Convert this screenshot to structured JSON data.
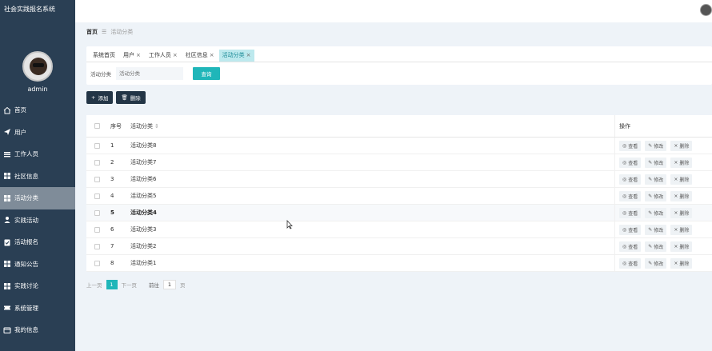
{
  "app": {
    "title": "社会实践报名系统"
  },
  "user": {
    "name": "admin"
  },
  "sidebar": {
    "items": [
      {
        "label": "首页",
        "icon": "home-icon",
        "active": false
      },
      {
        "label": "用户",
        "icon": "send-icon",
        "active": false
      },
      {
        "label": "工作人员",
        "icon": "list-icon",
        "active": false
      },
      {
        "label": "社区信息",
        "icon": "grid-icon",
        "active": false
      },
      {
        "label": "活动分类",
        "icon": "grid-icon",
        "active": true
      },
      {
        "label": "实践活动",
        "icon": "person-icon",
        "active": false
      },
      {
        "label": "活动报名",
        "icon": "clipboard-icon",
        "active": false
      },
      {
        "label": "通知公告",
        "icon": "grid-icon",
        "active": false
      },
      {
        "label": "实践讨论",
        "icon": "grid-icon",
        "active": false
      },
      {
        "label": "系统管理",
        "icon": "ticket-icon",
        "active": false
      },
      {
        "label": "我的信息",
        "icon": "card-icon",
        "active": false
      }
    ]
  },
  "breadcrumb": {
    "home": "首页",
    "separator": "☰",
    "current": "活动分类"
  },
  "tabs": [
    {
      "label": "系统首页",
      "closable": false,
      "active": false
    },
    {
      "label": "用户",
      "closable": true,
      "active": false
    },
    {
      "label": "工作人员",
      "closable": true,
      "active": false
    },
    {
      "label": "社区信息",
      "closable": true,
      "active": false
    },
    {
      "label": "活动分类",
      "closable": true,
      "active": true
    }
  ],
  "search": {
    "label": "活动分类",
    "placeholder": "活动分类",
    "button": "查询"
  },
  "toolbar": {
    "add_label": "添加",
    "delete_label": "删除"
  },
  "table": {
    "headers": {
      "index": "序号",
      "name": "活动分类",
      "ops": "操作"
    },
    "ops": {
      "view": "查看",
      "edit": "修改",
      "delete": "删除"
    },
    "rows": [
      {
        "index": "1",
        "name": "活动分类8"
      },
      {
        "index": "2",
        "name": "活动分类7"
      },
      {
        "index": "3",
        "name": "活动分类6"
      },
      {
        "index": "4",
        "name": "活动分类5"
      },
      {
        "index": "5",
        "name": "活动分类4"
      },
      {
        "index": "6",
        "name": "活动分类3"
      },
      {
        "index": "7",
        "name": "活动分类2"
      },
      {
        "index": "8",
        "name": "活动分类1"
      }
    ]
  },
  "pagination": {
    "prev": "上一页",
    "current": "1",
    "next": "下一页",
    "goto": "前往",
    "page_value": "1",
    "page_unit": "页"
  },
  "colors": {
    "sidebar": "#2a3f54",
    "accent": "#1fb6b9",
    "active_nav": "#7f8c99"
  }
}
